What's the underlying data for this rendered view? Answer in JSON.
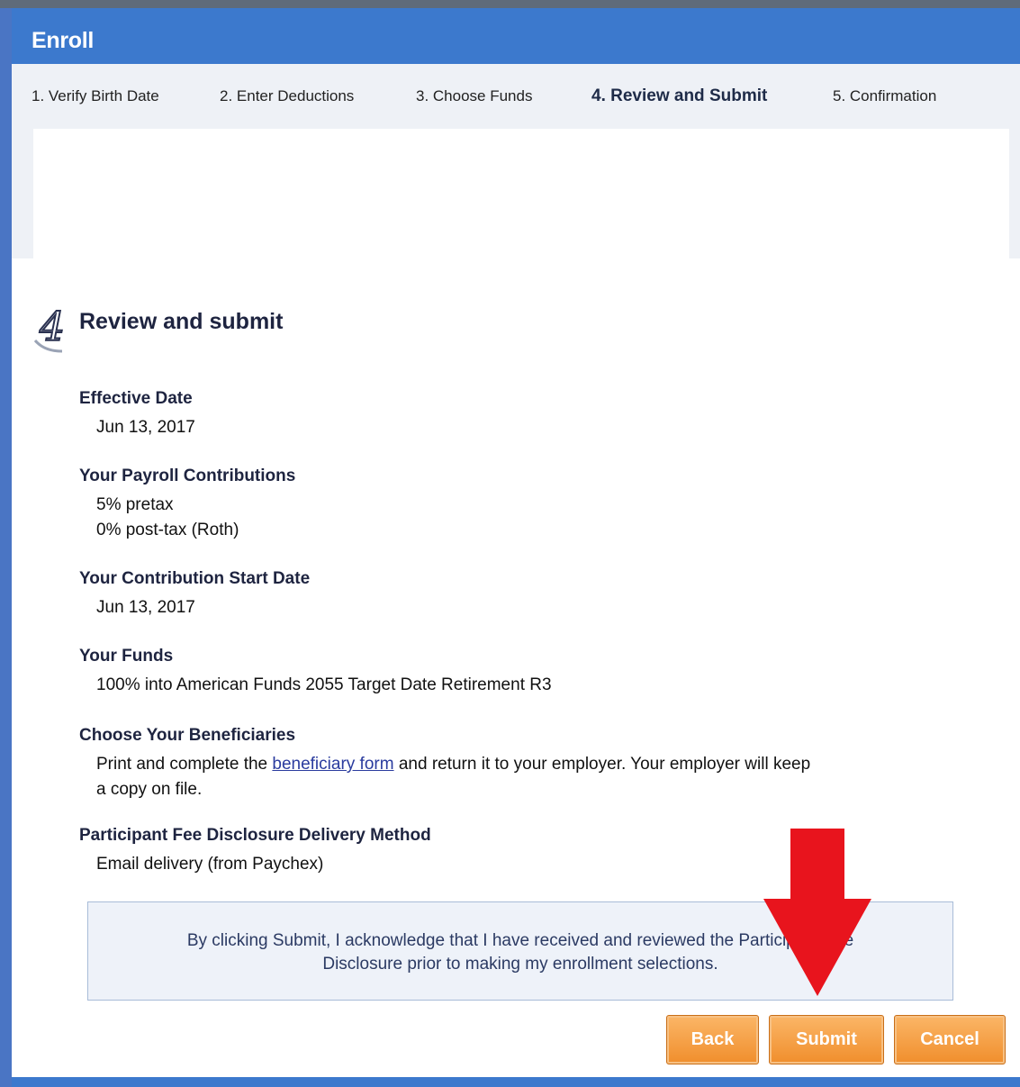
{
  "header": {
    "title": "Enroll"
  },
  "steps": [
    {
      "label": "1. Verify Birth Date",
      "active": false
    },
    {
      "label": "2. Enter Deductions",
      "active": false
    },
    {
      "label": "3. Choose Funds",
      "active": false
    },
    {
      "label": "4. Review and Submit",
      "active": true
    },
    {
      "label": "5. Confirmation",
      "active": false
    }
  ],
  "section": {
    "number": "4",
    "title": "Review and submit"
  },
  "items": {
    "effective_date": {
      "label": "Effective Date",
      "value": "Jun 13, 2017"
    },
    "payroll": {
      "label": "Your Payroll Contributions",
      "pretax": "5% pretax",
      "posttax": "0% post-tax (Roth)"
    },
    "start_date": {
      "label": "Your Contribution Start Date",
      "value": "Jun 13, 2017"
    },
    "funds": {
      "label": "Your Funds",
      "value": "100% into American Funds 2055 Target Date Retirement R3"
    },
    "beneficiaries": {
      "label": "Choose Your Beneficiaries",
      "text_before": "Print and complete the ",
      "link": "beneficiary form",
      "text_after_line1": " and return it to your employer. Your employer will keep",
      "text_line2": "a copy on file."
    },
    "fee_disclosure": {
      "label": "Participant Fee Disclosure Delivery Method",
      "value": "Email delivery (from Paychex)"
    }
  },
  "acknowledgement": {
    "line1": "By clicking Submit, I acknowledge that I have received and reviewed the Participant Fee",
    "line2": "Disclosure prior to making my enrollment selections."
  },
  "buttons": {
    "back": "Back",
    "submit": "Submit",
    "cancel": "Cancel"
  },
  "colors": {
    "header": "#3c79cd",
    "button": "#f5a04a",
    "arrow": "#e8141d"
  }
}
